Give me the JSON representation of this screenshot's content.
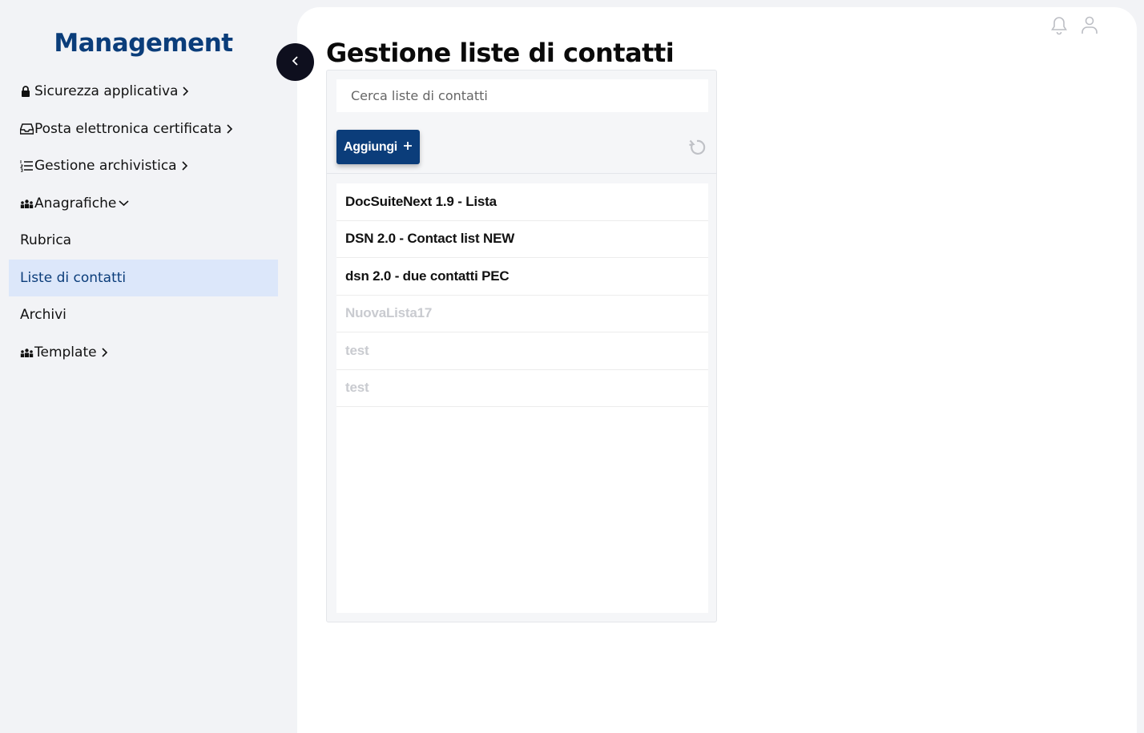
{
  "sidebar": {
    "brand": "Management",
    "items": [
      {
        "label": "Sicurezza applicativa",
        "icon": "lock-icon",
        "chevron": "right"
      },
      {
        "label": "Posta elettronica certificata",
        "icon": "inbox-icon",
        "chevron": "right"
      },
      {
        "label": "Gestione archivistica",
        "icon": "list-ordered-icon",
        "chevron": "right"
      },
      {
        "label": "Anagrafiche",
        "icon": "people-icon",
        "chevron": "down"
      },
      {
        "label": "Rubrica"
      },
      {
        "label": "Liste di contatti",
        "active": true
      },
      {
        "label": "Archivi"
      },
      {
        "label": "Template",
        "icon": "people-icon",
        "chevron": "right"
      }
    ]
  },
  "header": {
    "icons": [
      "bell-icon",
      "user-icon"
    ]
  },
  "main": {
    "title": "Gestione liste di contatti",
    "search_placeholder": "Cerca liste di contatti",
    "add_label": "Aggiungi",
    "lists": [
      {
        "name": "DocSuiteNext 1.9 - Lista",
        "enabled": true
      },
      {
        "name": "DSN 2.0 - Contact list NEW",
        "enabled": true
      },
      {
        "name": "dsn 2.0 - due contatti PEC",
        "enabled": true
      },
      {
        "name": "NuovaLista17",
        "enabled": false
      },
      {
        "name": "test",
        "enabled": false
      },
      {
        "name": "test",
        "enabled": false
      }
    ]
  },
  "colors": {
    "brand": "#0b3d7a",
    "active_bg": "#dce7fa",
    "disabled_text": "#c9cbd0"
  }
}
